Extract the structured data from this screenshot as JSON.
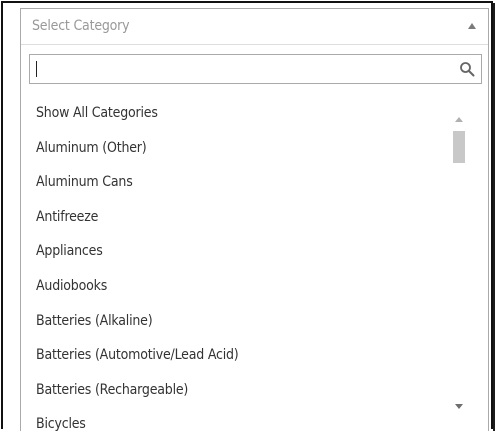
{
  "select": {
    "placeholder": "Select Category"
  },
  "search": {
    "value": ""
  },
  "options": [
    "Show All Categories",
    "Aluminum (Other)",
    "Aluminum Cans",
    "Antifreeze",
    "Appliances",
    "Audiobooks",
    "Batteries (Alkaline)",
    "Batteries (Automotive/Lead Acid)",
    "Batteries (Rechargeable)",
    "Bicycles"
  ],
  "colors": {
    "border": "#aaaaaa",
    "placeholder": "#999999",
    "text": "#333333",
    "scroll_thumb": "#c8c8c8"
  },
  "icons": {
    "collapse": "caret-up-icon",
    "search": "magnifier-icon",
    "scroll_up": "caret-up-icon",
    "scroll_down": "caret-down-icon"
  }
}
